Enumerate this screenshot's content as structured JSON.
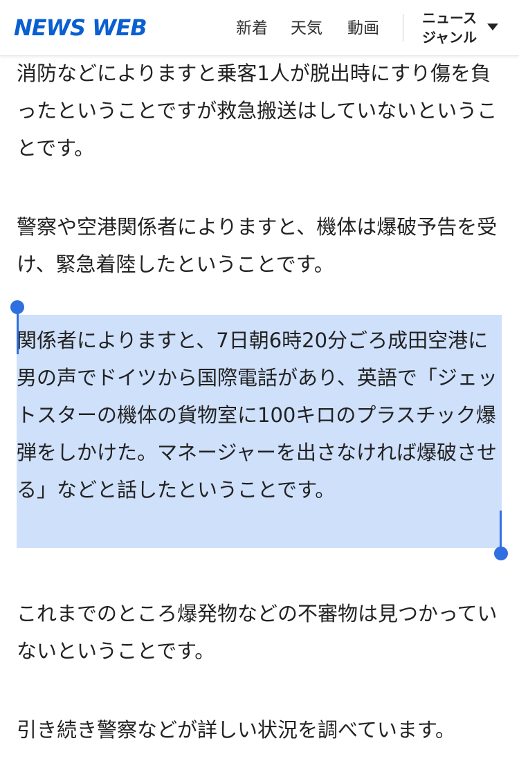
{
  "header": {
    "logo": "NEWS WEB",
    "nav": {
      "new": "新着",
      "weather": "天気",
      "video": "動画"
    },
    "genre": {
      "line1": "ニュース",
      "line2": "ジャンル",
      "icon": "caret-down-icon"
    }
  },
  "article": {
    "paragraphs": [
      "消防などによりますと乗客1人が脱出時にすり傷を負ったということですが救急搬送はしていないということです。",
      "警察や空港関係者によりますと、機体は爆破予告を受け、緊急着陸したということです。",
      "関係者によりますと、7日朝6時20分ごろ成田空港に男の声でドイツから国際電話があり、英語で「ジェットスターの機体の貨物室に100キロのプラスチック爆弾をしかけた。マネージャーを出さなければ爆破させる」などと話したということです。",
      "これまでのところ爆発物などの不審物は見つかっていないということです。",
      "引き続き警察などが詳しい状況を調べています。"
    ]
  },
  "colors": {
    "brand": "#0a5fd1",
    "selection": "#cfe0fb",
    "handle": "#2f6fe0"
  }
}
